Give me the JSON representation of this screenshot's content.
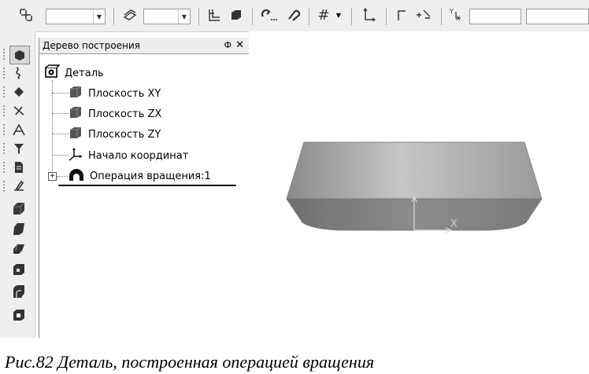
{
  "toolbar": {
    "items": [
      {
        "icon": "snap-icon"
      },
      {
        "icon": "layers-icon"
      },
      {
        "icon": "grid-lines-icon"
      },
      {
        "icon": "solid-icon"
      },
      {
        "icon": "magnet-icon"
      },
      {
        "icon": "magnet-alt-icon"
      },
      {
        "icon": "grid-icon"
      },
      {
        "icon": "axis-icon"
      },
      {
        "icon": "corner-icon"
      },
      {
        "icon": "snap-point-icon"
      },
      {
        "icon": "coordinates-icon"
      }
    ],
    "combos": [
      {
        "value": ""
      },
      {
        "value": ""
      },
      {
        "value": ""
      },
      {
        "value": ""
      }
    ]
  },
  "tree": {
    "title": "Дерево построения",
    "pin": "Ф",
    "close": "✕",
    "root": {
      "label": "Деталь",
      "icon": "part-icon"
    },
    "nodes": [
      {
        "label": "Плоскость XY",
        "icon": "plane-icon"
      },
      {
        "label": "Плоскость ZX",
        "icon": "plane-icon"
      },
      {
        "label": "Плоскость ZY",
        "icon": "plane-icon"
      },
      {
        "label": "Начало координат",
        "icon": "origin-icon"
      },
      {
        "label": "Операция вращения:1",
        "icon": "revolve-icon",
        "expander": "+"
      }
    ]
  },
  "viewport": {
    "axis_label": "X",
    "body_color": "#8c8c8c",
    "top_color": "#b4b4b4"
  },
  "caption": "Рис.82 Деталь, построенная операцией вращения"
}
